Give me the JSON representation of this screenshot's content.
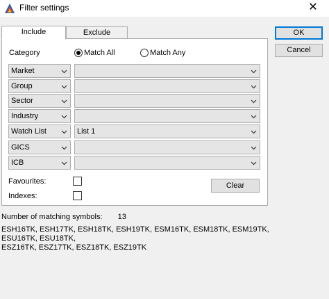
{
  "window": {
    "title": "Filter settings",
    "close_glyph": "✕",
    "app_icon": "app-logo-icon"
  },
  "tabs": [
    {
      "label": "Include",
      "active": true
    },
    {
      "label": "Exclude",
      "active": false
    }
  ],
  "buttons": {
    "ok": "OK",
    "cancel": "Cancel",
    "clear": "Clear"
  },
  "category": {
    "label": "Category",
    "options": [
      {
        "label": "Match All",
        "selected": true
      },
      {
        "label": "Match Any",
        "selected": false
      }
    ]
  },
  "filters": [
    {
      "field": "Market",
      "value": ""
    },
    {
      "field": "Group",
      "value": ""
    },
    {
      "field": "Sector",
      "value": ""
    },
    {
      "field": "Industry",
      "value": ""
    },
    {
      "field": "Watch List",
      "value": "List 1"
    },
    {
      "field": "GICS",
      "value": ""
    },
    {
      "field": "ICB",
      "value": ""
    }
  ],
  "checkboxes": {
    "favourites": {
      "label": "Favourites:",
      "checked": false
    },
    "indexes": {
      "label": "Indexes:",
      "checked": false
    }
  },
  "matching": {
    "label": "Number of matching symbols:",
    "count": "13",
    "symbols_line1": "ESH16TK, ESH17TK, ESH18TK, ESH19TK, ESM16TK, ESM18TK, ESM19TK, ESU16TK, ESU18TK,",
    "symbols_line2": "ESZ16TK, ESZ17TK, ESZ18TK, ESZ19TK"
  },
  "colors": {
    "accent": "#0078d7",
    "panel_bg": "#ffffff",
    "dialog_bg": "#f0f0f0",
    "combo_bg": "#e5e5e5"
  }
}
